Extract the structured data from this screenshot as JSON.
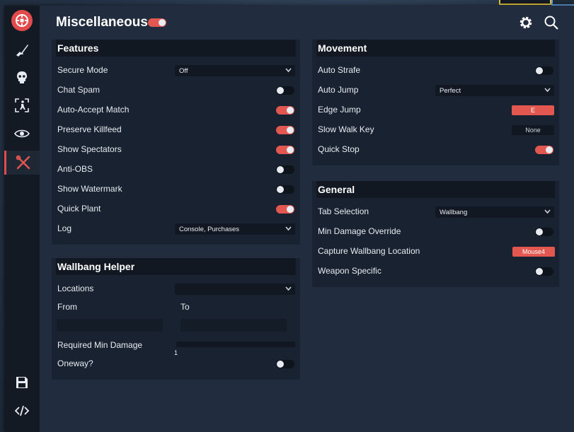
{
  "page": {
    "title": "Miscellaneous",
    "master_enabled": true
  },
  "sidebar": {
    "items": [
      {
        "icon": "rifle-icon"
      },
      {
        "icon": "skull-icon"
      },
      {
        "icon": "player-target-icon"
      },
      {
        "icon": "eye-icon"
      },
      {
        "icon": "tools-icon",
        "active": true
      }
    ],
    "bottom": [
      {
        "icon": "save-icon"
      },
      {
        "icon": "code-icon"
      }
    ]
  },
  "header": {
    "icons": [
      "gear-icon",
      "search-icon"
    ]
  },
  "features": {
    "title": "Features",
    "secure_mode": {
      "label": "Secure Mode",
      "value": "Off"
    },
    "chat_spam": {
      "label": "Chat Spam",
      "on": false
    },
    "auto_accept": {
      "label": "Auto-Accept Match",
      "on": true
    },
    "preserve_killfeed": {
      "label": "Preserve Killfeed",
      "on": true
    },
    "show_spectators": {
      "label": "Show Spectators",
      "on": true
    },
    "anti_obs": {
      "label": "Anti-OBS",
      "on": false
    },
    "show_watermark": {
      "label": "Show Watermark",
      "on": false
    },
    "quick_plant": {
      "label": "Quick Plant",
      "on": true
    },
    "log": {
      "label": "Log",
      "value": "Console, Purchases"
    }
  },
  "wallbang": {
    "title": "Wallbang Helper",
    "locations": {
      "label": "Locations",
      "value": ""
    },
    "from_label": "From",
    "to_label": "To",
    "min_damage": {
      "label": "Required Min Damage",
      "value": "1"
    },
    "oneway": {
      "label": "Oneway?",
      "on": false
    }
  },
  "movement": {
    "title": "Movement",
    "auto_strafe": {
      "label": "Auto Strafe",
      "on": false
    },
    "auto_jump": {
      "label": "Auto Jump",
      "value": "Perfect"
    },
    "edge_jump": {
      "label": "Edge Jump",
      "key": "E"
    },
    "slow_walk": {
      "label": "Slow Walk Key",
      "key": "None"
    },
    "quick_stop": {
      "label": "Quick Stop",
      "on": true
    }
  },
  "general": {
    "title": "General",
    "tab_selection": {
      "label": "Tab Selection",
      "value": "Wallbang"
    },
    "min_damage_override": {
      "label": "Min Damage Override",
      "on": false
    },
    "capture_location": {
      "label": "Capture Wallbang Location",
      "key": "Mouse4"
    },
    "weapon_specific": {
      "label": "Weapon Specific",
      "on": false
    }
  },
  "colors": {
    "accent": "#e2574f",
    "sidebar": "#131a24",
    "panel": "#182230"
  }
}
